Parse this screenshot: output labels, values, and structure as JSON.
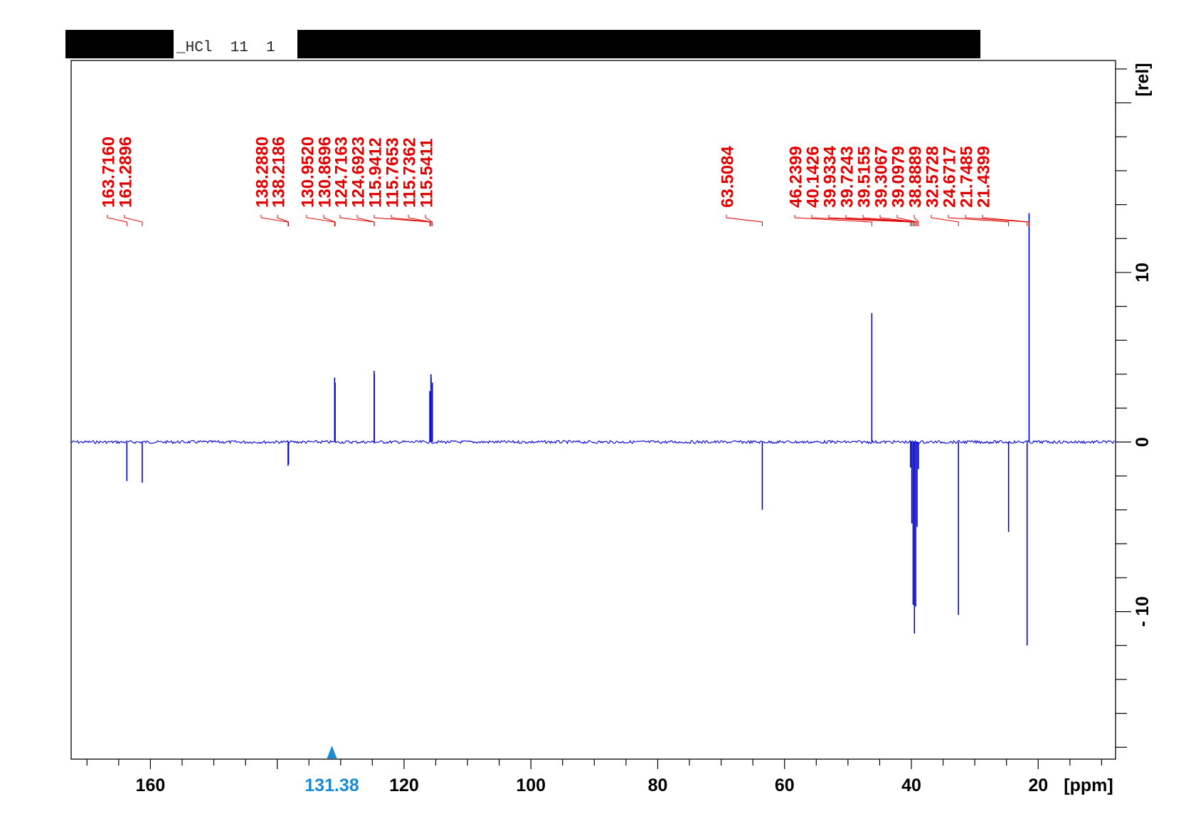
{
  "header": {
    "filename_text": "_HCl  11  1",
    "redaction_color": "#000000"
  },
  "colors": {
    "spectrum": "#0000e6",
    "peak_labels": "#e00000",
    "cursor": "#1a8ad4",
    "axis": "#000000"
  },
  "cursor": {
    "value": 131.38,
    "label": "131.38"
  },
  "chart_data": {
    "type": "line",
    "title": "",
    "xlabel": "[ppm]",
    "ylabel": "[rel]",
    "xlim": [
      172.5,
      7.8
    ],
    "ylim": [
      -18.7,
      22.5
    ],
    "x_reversed": true,
    "grid": false,
    "x_ticks": [
      160,
      120,
      100,
      80,
      60,
      40,
      20
    ],
    "x_tick_labels": [
      "160",
      "120",
      "100",
      "80",
      "60",
      "40",
      "20"
    ],
    "y_ticks": [
      10,
      0,
      -10
    ],
    "y_tick_labels": [
      "10",
      "0",
      "- 10"
    ],
    "peak_labels": [
      "163.7160",
      "161.2896",
      "138.2880",
      "138.2186",
      "130.9520",
      "130.8696",
      "124.7163",
      "124.6923",
      "115.9412",
      "115.7653",
      "115.7362",
      "115.5411",
      "63.5084",
      "46.2399",
      "40.1426",
      "39.9334",
      "39.7243",
      "39.5155",
      "39.3067",
      "39.0979",
      "38.8889",
      "32.5728",
      "24.6717",
      "21.7485",
      "21.4399"
    ],
    "series": [
      {
        "peaks": [
          {
            "x": 163.716,
            "y": -2.3
          },
          {
            "x": 161.2896,
            "y": -2.4
          },
          {
            "x": 138.288,
            "y": -1.4
          },
          {
            "x": 138.2186,
            "y": -1.3
          },
          {
            "x": 130.952,
            "y": 3.8
          },
          {
            "x": 130.8696,
            "y": 3.5
          },
          {
            "x": 124.7163,
            "y": 4.2
          },
          {
            "x": 124.6923,
            "y": 4.0
          },
          {
            "x": 115.9412,
            "y": 3.0
          },
          {
            "x": 115.7653,
            "y": 4.0
          },
          {
            "x": 115.7362,
            "y": 3.8
          },
          {
            "x": 115.5411,
            "y": 3.5
          },
          {
            "x": 63.5084,
            "y": -4.0
          },
          {
            "x": 46.2399,
            "y": 7.6
          },
          {
            "x": 40.1426,
            "y": -1.5
          },
          {
            "x": 39.9334,
            "y": -4.8
          },
          {
            "x": 39.7243,
            "y": -9.6
          },
          {
            "x": 39.5155,
            "y": -11.3
          },
          {
            "x": 39.3067,
            "y": -9.7
          },
          {
            "x": 39.0979,
            "y": -5.0
          },
          {
            "x": 38.8889,
            "y": -1.6
          },
          {
            "x": 32.5728,
            "y": -10.2
          },
          {
            "x": 24.6717,
            "y": -5.3
          },
          {
            "x": 21.7485,
            "y": -12.0
          },
          {
            "x": 21.4399,
            "y": 13.5
          }
        ]
      }
    ]
  }
}
